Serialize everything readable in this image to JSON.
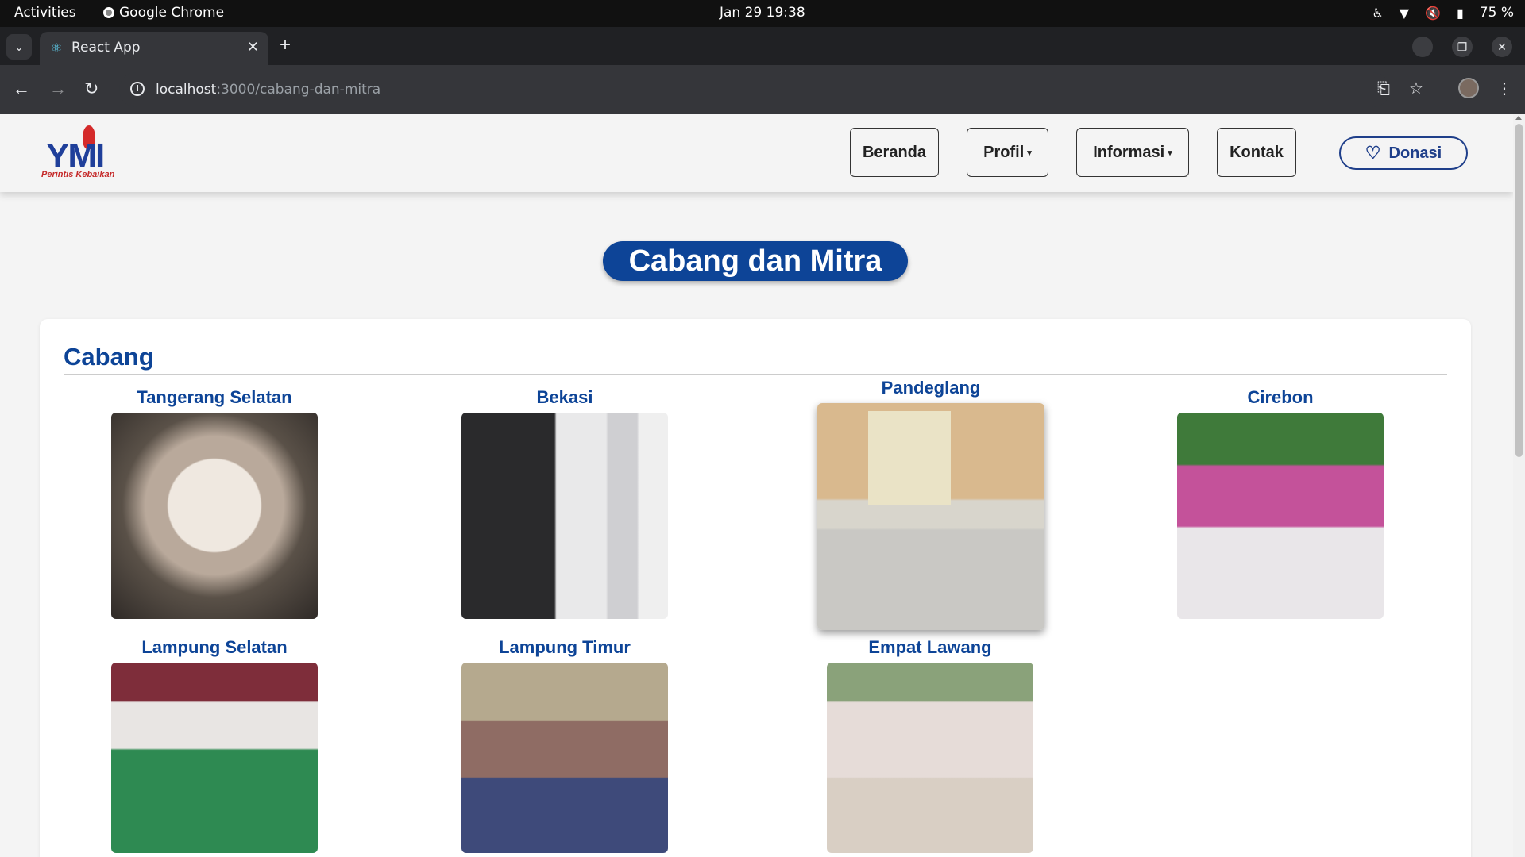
{
  "os_bar": {
    "activities": "Activities",
    "app_name": "Google Chrome",
    "clock": "Jan 29  19:38",
    "battery": "75 %"
  },
  "browser": {
    "tab_title": "React App",
    "url_host": "localhost",
    "url_path": ":3000/cabang-dan-mitra"
  },
  "navbar": {
    "logo_tagline": "Perintis Kebaikan",
    "logo_text": "YMI",
    "items": [
      {
        "label": "Beranda",
        "dropdown": false
      },
      {
        "label": "Profil",
        "dropdown": true
      },
      {
        "label": "Informasi",
        "dropdown": true
      },
      {
        "label": "Kontak",
        "dropdown": false
      }
    ],
    "donate_label": "Donasi"
  },
  "page": {
    "title": "Cabang dan Mitra",
    "section_title": "Cabang",
    "branches": [
      {
        "name": "Tangerang Selatan",
        "photo_desc": "women eating together"
      },
      {
        "name": "Bekasi",
        "photo_desc": "man giving to children"
      },
      {
        "name": "Pandeglang",
        "photo_desc": "children with banner"
      },
      {
        "name": "Cirebon",
        "photo_desc": "children with banner outdoors"
      },
      {
        "name": "Lampung Selatan",
        "photo_desc": "children eating on green floor"
      },
      {
        "name": "Lampung Timur",
        "photo_desc": "children sitting with banner"
      },
      {
        "name": "Empat Lawang",
        "photo_desc": "group with banner outdoors"
      }
    ]
  }
}
